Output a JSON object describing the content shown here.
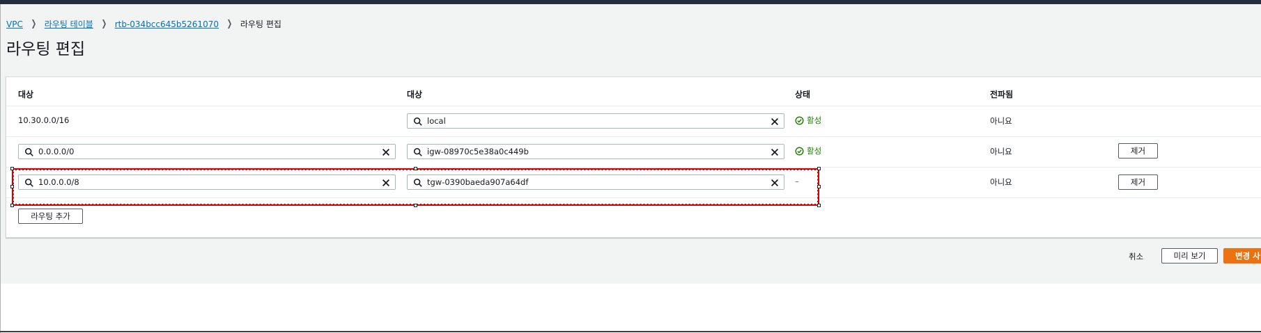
{
  "breadcrumb": {
    "items": [
      "VPC",
      "라우팅 테이블",
      "rtb-034bcc645b5261070"
    ],
    "current": "라우팅 편집"
  },
  "page_title": "라우팅 편집",
  "table": {
    "headers": [
      "대상",
      "대상",
      "상태",
      "전파됨"
    ],
    "rows": [
      {
        "destination": "10.30.0.0/16",
        "target": "local",
        "status": "활성",
        "propagated": "아니요"
      },
      {
        "destination": "0.0.0.0/0",
        "target": "igw-08970c5e38a0c449b",
        "status": "활성",
        "propagated": "아니요",
        "remove": "제거"
      },
      {
        "destination": "10.0.0.0/8",
        "target": "tgw-0390baeda907a64df",
        "status": "–",
        "propagated": "아니요",
        "remove": "제거"
      }
    ],
    "add_route": "라우팅 추가"
  },
  "footer": {
    "cancel": "취소",
    "preview": "미리 보기",
    "save": "변경 사"
  },
  "colors": {
    "accent": "#ec7211",
    "link": "#0073bb",
    "success": "#1d8102",
    "selection": "#d40000"
  },
  "icons": [
    "search-icon",
    "clear-icon",
    "status-ok-icon",
    "chevron-right-icon"
  ]
}
